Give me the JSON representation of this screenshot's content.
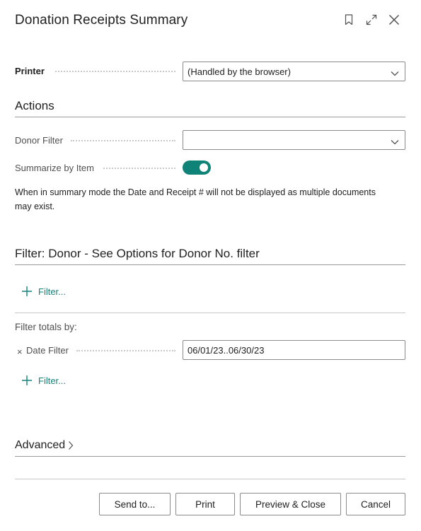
{
  "dialog": {
    "title": "Donation Receipts Summary",
    "icons": [
      "bookmark-icon",
      "expand-icon",
      "close-icon"
    ]
  },
  "printer": {
    "label": "Printer",
    "value": "(Handled by the browser)"
  },
  "actions": {
    "title": "Actions",
    "donor_filter": {
      "label": "Donor Filter",
      "value": ""
    },
    "summarize": {
      "label": "Summarize by Item",
      "enabled": true
    },
    "note": "When in summary mode the Date and Receipt # will not be displayed as multiple documents may exist."
  },
  "donor_filter_section": {
    "title": "Filter: Donor - See Options for Donor No. filter",
    "add_filter_label": "Filter..."
  },
  "totals": {
    "title": "Filter totals by:",
    "remove_symbol": "×",
    "date_filter": {
      "label": "Date Filter",
      "value": "06/01/23..06/30/23"
    },
    "add_filter_label": "Filter..."
  },
  "advanced": {
    "label": "Advanced"
  },
  "buttons": {
    "send_to": "Send to...",
    "print": "Print",
    "preview_close": "Preview & Close",
    "cancel": "Cancel"
  },
  "colors": {
    "accent": "#108379",
    "border": "#8a8a8a",
    "divider": "#9a9a9a"
  }
}
